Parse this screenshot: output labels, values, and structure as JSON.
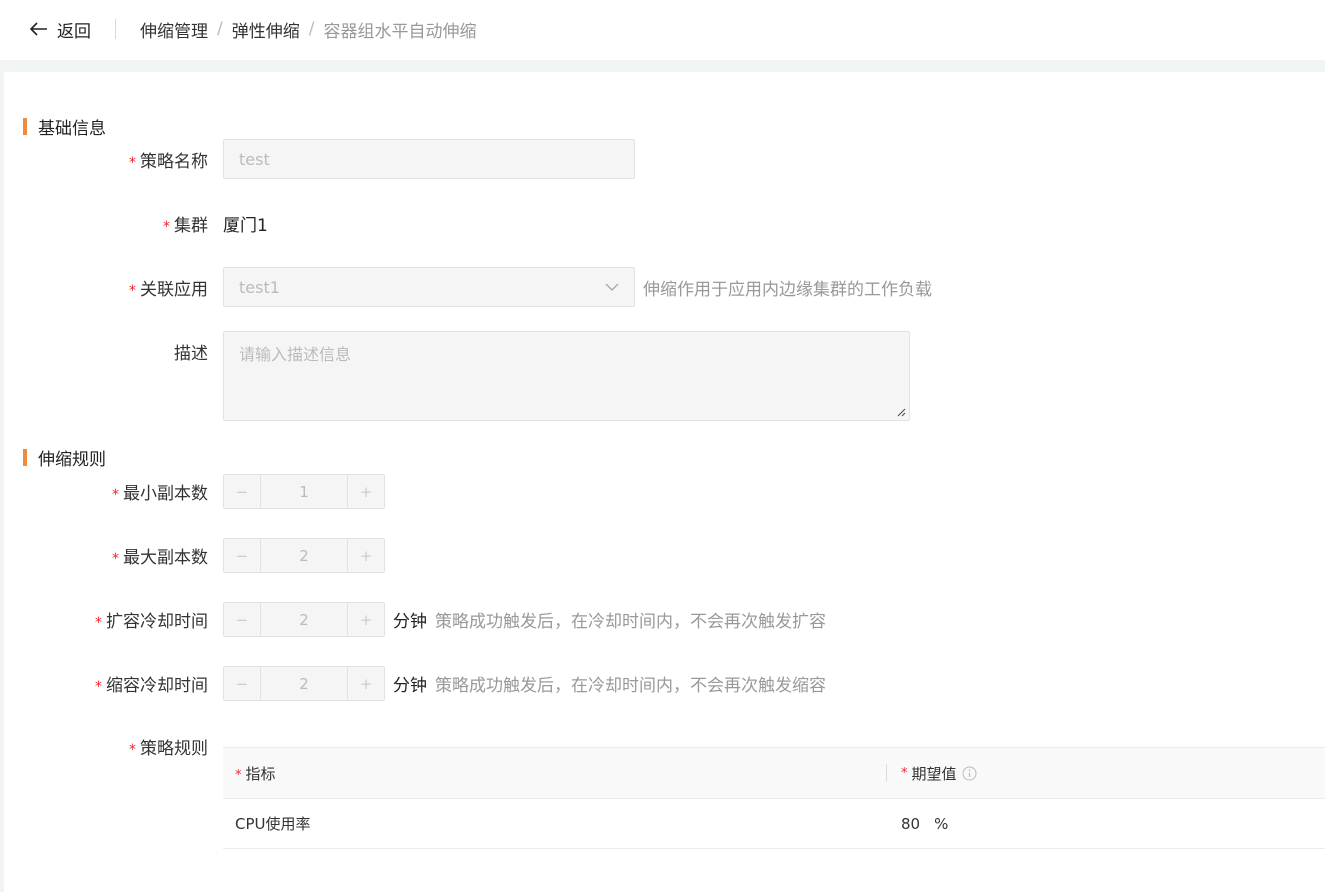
{
  "header": {
    "back_label": "返回",
    "breadcrumb": [
      "伸缩管理",
      "弹性伸缩",
      "容器组水平自动伸缩"
    ]
  },
  "basic_section": {
    "title": "基础信息"
  },
  "form": {
    "policy_name": {
      "label": "策略名称",
      "value": "test",
      "required": true
    },
    "cluster": {
      "label": "集群",
      "value": "厦门1",
      "required": true
    },
    "app": {
      "label": "关联应用",
      "value": "test1",
      "hint": "伸缩作用于应用内边缘集群的工作负载",
      "required": true
    },
    "description": {
      "label": "描述",
      "placeholder": "请输入描述信息"
    }
  },
  "rules_section": {
    "title": "伸缩规则"
  },
  "rules": {
    "min_replicas": {
      "label": "最小副本数",
      "value": "1"
    },
    "max_replicas": {
      "label": "最大副本数",
      "value": "2"
    },
    "scale_up_cooldown": {
      "label": "扩容冷却时间",
      "value": "2",
      "unit": "分钟",
      "hint": "策略成功触发后，在冷却时间内，不会再次触发扩容"
    },
    "scale_down_cooldown": {
      "label": "缩容冷却时间",
      "value": "2",
      "unit": "分钟",
      "hint": "策略成功触发后，在冷却时间内，不会再次触发缩容"
    },
    "policy_rules_label": "策略规则"
  },
  "required_mark": "*",
  "stepper": {
    "minus": "−",
    "plus": "+"
  },
  "metrics_table": {
    "headers": [
      "指标",
      "期望值"
    ],
    "rows": [
      {
        "metric": "CPU使用率",
        "value": "80",
        "unit": "%"
      }
    ]
  },
  "colors": {
    "accent": "#f08a3c",
    "required": "#f5222d"
  }
}
